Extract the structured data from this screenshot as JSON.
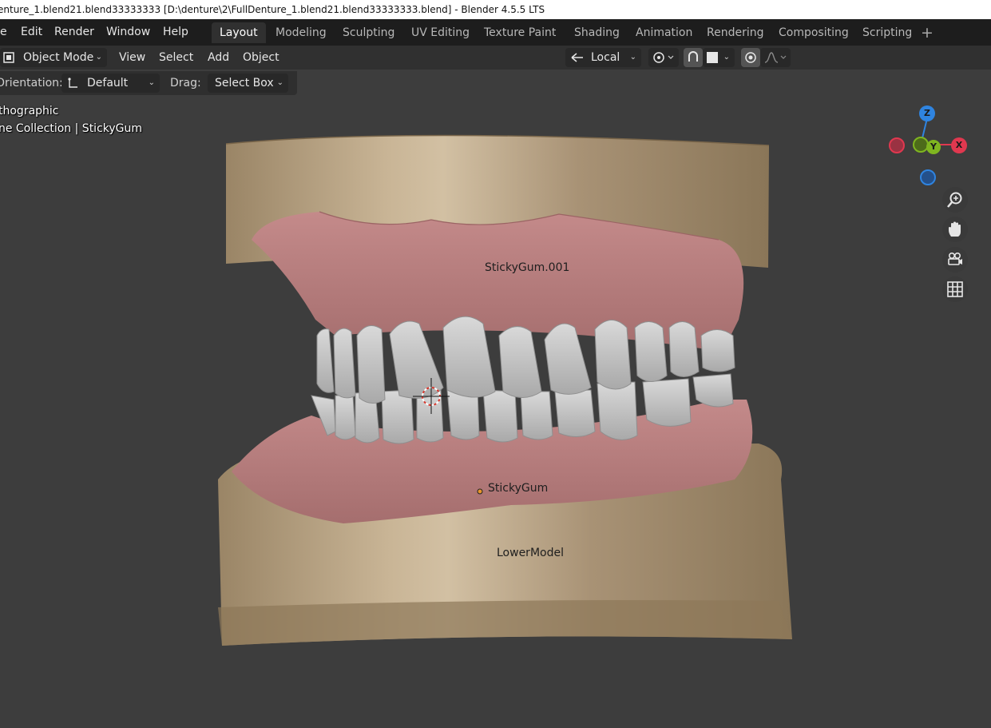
{
  "window": {
    "title": "enture_1.blend21.blend33333333 [D:\\denture\\2\\FullDenture_1.blend21.blend33333333.blend] - Blender 4.5.5 LTS"
  },
  "menubar": {
    "items": [
      "e",
      "Edit",
      "Render",
      "Window",
      "Help"
    ]
  },
  "workspaces": {
    "tabs": [
      "Layout",
      "Modeling",
      "Sculpting",
      "UV Editing",
      "Texture Paint",
      "Shading",
      "Animation",
      "Rendering",
      "Compositing",
      "Scripting"
    ],
    "active": "Layout",
    "add_icon": "plus-icon"
  },
  "header": {
    "mode": "Object Mode",
    "menus": [
      "View",
      "Select",
      "Add",
      "Object"
    ],
    "transform_orientation": "Local",
    "icons": [
      "pivot-icon",
      "snap-icon",
      "proportional-edit-icon",
      "falloff-icon"
    ]
  },
  "tool_settings": {
    "orientation_label": "Orientation:",
    "orientation_value": "Default",
    "drag_label": "Drag:",
    "drag_value": "Select Box"
  },
  "viewport": {
    "view_name": "thographic",
    "collection_info": "ne Collection | StickyGum",
    "object_labels": {
      "upper_gum": "StickyGum.001",
      "lower_gum": "StickyGum",
      "lower_model": "LowerModel"
    },
    "colors": {
      "background": "#3d3d3d",
      "model_base": "#c2ad8c",
      "gum": "#b87c7c",
      "teeth": "#c9c9c9"
    }
  },
  "gizmo": {
    "axes": [
      "Z",
      "Y",
      "X"
    ],
    "colors": {
      "x": "#e0384f",
      "y": "#7fb520",
      "z": "#2f84e0"
    }
  },
  "nav_buttons": [
    "zoom-icon",
    "hand-pan-icon",
    "camera-icon",
    "grid-icon"
  ]
}
